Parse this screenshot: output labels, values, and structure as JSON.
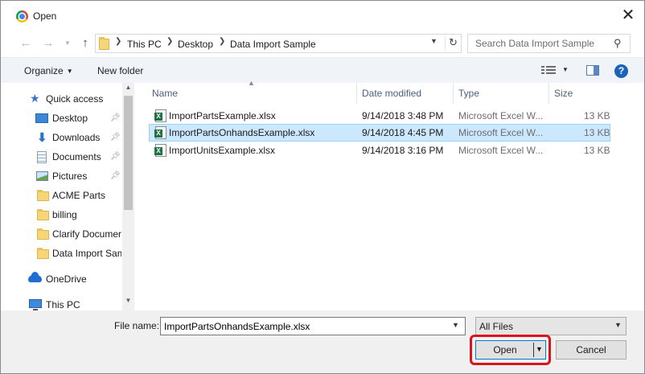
{
  "window": {
    "title": "Open"
  },
  "address": {
    "breadcrumbs": [
      "This PC",
      "Desktop",
      "Data Import Sample"
    ],
    "search_placeholder": "Search Data Import Sample"
  },
  "toolbar": {
    "organize_label": "Organize",
    "new_folder_label": "New folder"
  },
  "sidebar": {
    "items": [
      {
        "label": "Quick access"
      },
      {
        "label": "Desktop"
      },
      {
        "label": "Downloads"
      },
      {
        "label": "Documents"
      },
      {
        "label": "Pictures"
      },
      {
        "label": "ACME Parts"
      },
      {
        "label": "billing"
      },
      {
        "label": "Clarify Documer"
      },
      {
        "label": "Data Import Sam"
      },
      {
        "label": "OneDrive"
      },
      {
        "label": "This PC"
      }
    ]
  },
  "columns": {
    "name": "Name",
    "date": "Date modified",
    "type": "Type",
    "size": "Size"
  },
  "files": [
    {
      "name": "ImportPartsExample.xlsx",
      "date": "9/14/2018 3:48 PM",
      "type": "Microsoft Excel W...",
      "size": "13 KB",
      "selected": false
    },
    {
      "name": "ImportPartsOnhandsExample.xlsx",
      "date": "9/14/2018 4:45 PM",
      "type": "Microsoft Excel W...",
      "size": "13 KB",
      "selected": true
    },
    {
      "name": "ImportUnitsExample.xlsx",
      "date": "9/14/2018 3:16 PM",
      "type": "Microsoft Excel W...",
      "size": "13 KB",
      "selected": false
    }
  ],
  "bottom": {
    "file_name_label": "File name:",
    "file_name_value": "ImportPartsOnhandsExample.xlsx",
    "file_type": "All Files",
    "open_label": "Open",
    "cancel_label": "Cancel"
  },
  "colors": {
    "highlight": "#d8141e",
    "selection": "#cce8ff",
    "accent": "#0078d7"
  }
}
